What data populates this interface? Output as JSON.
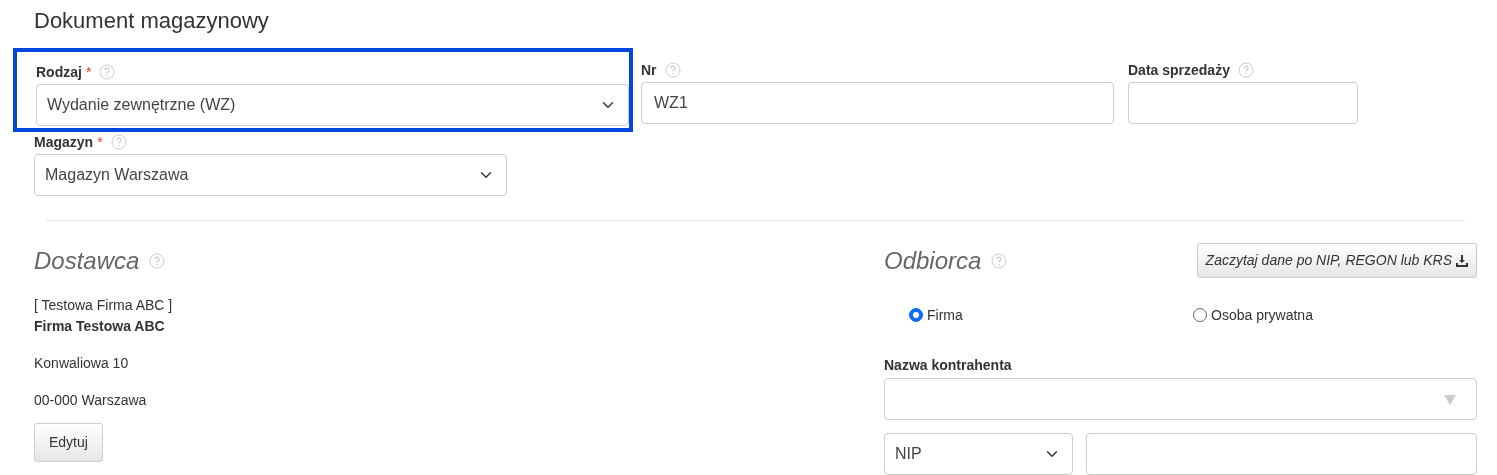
{
  "title": "Dokument magazynowy",
  "top_fields": [
    {
      "label": "Rodzaj",
      "required_mark": "*",
      "kind": "select",
      "value": "Wydanie zewnętrzne (WZ)",
      "highlighted": true
    },
    {
      "label": "Nr",
      "kind": "input",
      "value": "WZ1",
      "highlighted": false
    },
    {
      "label": "Data sprzedaży",
      "kind": "input",
      "highlighted": false
    }
  ],
  "warehouse": {
    "label": "Magazyn",
    "required_mark": "*",
    "value": "Magazyn Warszawa"
  },
  "supplier": {
    "heading": "Dostawca",
    "short_name": "[ Testowa Firma ABC ]",
    "name": "Firma Testowa ABC",
    "street": "Konwaliowa 10",
    "city": "00-000 Warszawa",
    "edit_button": "Edytuj"
  },
  "recipient": {
    "heading": "Odbiorca",
    "fetch_button": "Zaczytaj dane po NIP, REGON lub KRS",
    "types": [
      {
        "label": "Firma",
        "selected": true
      },
      {
        "label": "Osoba prywatna",
        "selected": false
      }
    ],
    "name_label": "Nazwa kontrahenta",
    "id_type": "NIP"
  }
}
